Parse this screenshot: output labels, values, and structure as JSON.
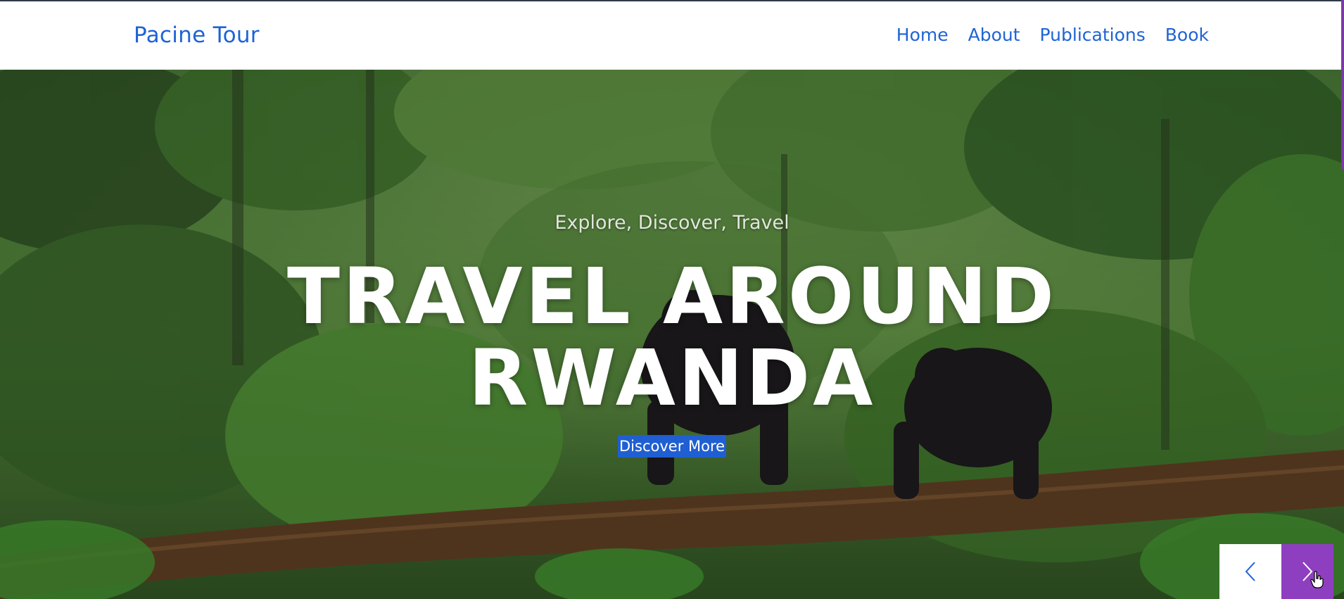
{
  "header": {
    "brand": "Pacine Tour",
    "nav": [
      {
        "label": "Home"
      },
      {
        "label": "About"
      },
      {
        "label": "Publications"
      },
      {
        "label": "Book"
      }
    ]
  },
  "hero": {
    "subtitle": "Explore, Discover, Travel",
    "title_line1": "TRAVEL AROUND",
    "title_line2": "RWANDA",
    "cta": "Discover More",
    "prev_icon": "chevron-left-icon",
    "next_icon": "chevron-right-icon"
  },
  "colors": {
    "link": "#1e63d6",
    "cta_bg": "#1f5fd2",
    "next_bg": "#8e3fbf"
  }
}
